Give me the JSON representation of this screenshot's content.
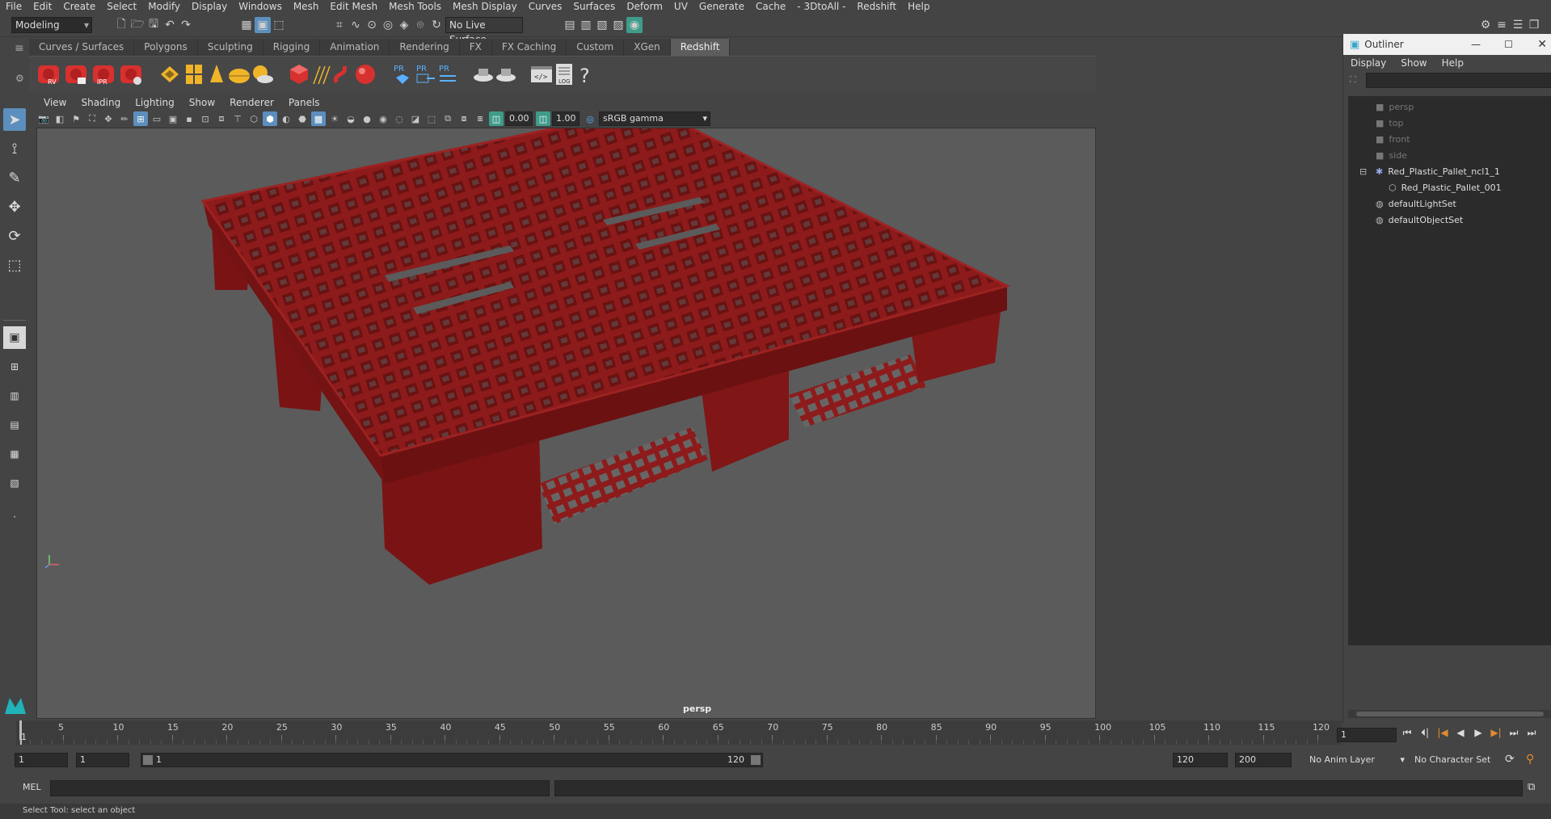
{
  "menubar": [
    "File",
    "Edit",
    "Create",
    "Select",
    "Modify",
    "Display",
    "Windows",
    "Mesh",
    "Edit Mesh",
    "Mesh Tools",
    "Mesh Display",
    "Curves",
    "Surfaces",
    "Deform",
    "UV",
    "Generate",
    "Cache",
    "- 3DtoAll -",
    "Redshift",
    "Help"
  ],
  "statusline": {
    "workspace": "Modeling",
    "live_surface": "No Live Surface"
  },
  "shelf_tabs": [
    "Curves / Surfaces",
    "Polygons",
    "Sculpting",
    "Rigging",
    "Animation",
    "Rendering",
    "FX",
    "FX Caching",
    "Custom",
    "XGen",
    "Redshift"
  ],
  "shelf_active": "Redshift",
  "shelf_icons": {
    "rv": "RV",
    "ipr": "IPR",
    "pr": "PR",
    "log": "LOG",
    "help": "?"
  },
  "panel_menu": [
    "View",
    "Shading",
    "Lighting",
    "Show",
    "Renderer",
    "Panels"
  ],
  "panel_toolbar": {
    "exposure": "0.00",
    "gamma": "1.00",
    "colorspace": "sRGB gamma"
  },
  "viewport": {
    "camera_label": "persp"
  },
  "outliner": {
    "title": "Outliner",
    "menu": [
      "Display",
      "Show",
      "Help"
    ],
    "items": [
      {
        "label": "persp",
        "kind": "camera"
      },
      {
        "label": "top",
        "kind": "camera"
      },
      {
        "label": "front",
        "kind": "camera"
      },
      {
        "label": "side",
        "kind": "camera"
      },
      {
        "label": "Red_Plastic_Pallet_ncl1_1",
        "kind": "group"
      },
      {
        "label": "Red_Plastic_Pallet_001",
        "kind": "mesh"
      },
      {
        "label": "defaultLightSet",
        "kind": "set"
      },
      {
        "label": "defaultObjectSet",
        "kind": "set"
      }
    ]
  },
  "timeline": {
    "ticks": [
      "5",
      "10",
      "15",
      "20",
      "25",
      "30",
      "35",
      "40",
      "45",
      "50",
      "55",
      "60",
      "65",
      "70",
      "75",
      "80",
      "85",
      "90",
      "95",
      "100",
      "105",
      "110",
      "115",
      "120"
    ],
    "current_frame": "1",
    "current_frame_marker": "1"
  },
  "range": {
    "start": "1",
    "playback_start": "1",
    "slider_start": "1",
    "slider_end": "120",
    "playback_end": "120",
    "end": "200",
    "anim_layer": "No Anim Layer",
    "character_set": "No Character Set"
  },
  "cmdline": {
    "label": "MEL"
  },
  "helpline": {
    "text": "Select Tool: select an object"
  },
  "colors": {
    "pallet": "#8b1a1a",
    "active": "#5c8fbd",
    "viewport_bg": "#5b5b5b"
  }
}
